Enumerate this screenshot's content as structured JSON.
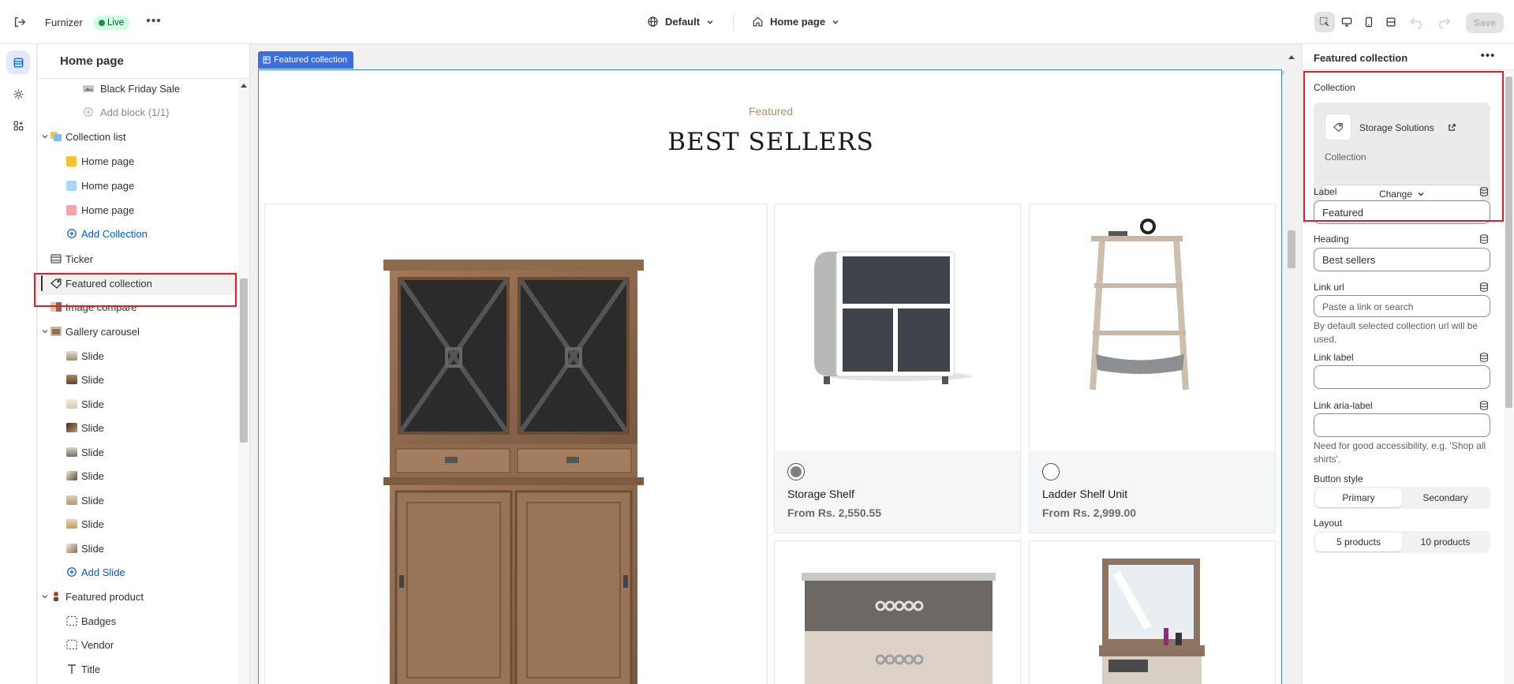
{
  "topbar": {
    "store_name": "Furnizer",
    "status": "Live",
    "theme": "Default",
    "page": "Home page",
    "save_label": "Save",
    "icons": [
      "exit-icon",
      "globe-icon",
      "home-icon",
      "inspector-icon",
      "desktop-icon",
      "mobile-icon",
      "fullwidth-icon",
      "undo-icon",
      "redo-icon"
    ]
  },
  "sidebar": {
    "title": "Home page",
    "items": [
      {
        "label": "Black Friday Sale"
      },
      {
        "label": "Add block (1/1)"
      },
      {
        "label": "Collection list"
      },
      {
        "label": "Home page"
      },
      {
        "label": "Home page"
      },
      {
        "label": "Home page"
      },
      {
        "label": "Add Collection"
      },
      {
        "label": "Ticker"
      },
      {
        "label": "Featured collection"
      },
      {
        "label": "Image compare"
      },
      {
        "label": "Gallery carousel"
      },
      {
        "label": "Slide"
      },
      {
        "label": "Slide"
      },
      {
        "label": "Slide"
      },
      {
        "label": "Slide"
      },
      {
        "label": "Slide"
      },
      {
        "label": "Slide"
      },
      {
        "label": "Slide"
      },
      {
        "label": "Slide"
      },
      {
        "label": "Slide"
      },
      {
        "label": "Add Slide"
      },
      {
        "label": "Featured product"
      },
      {
        "label": "Badges"
      },
      {
        "label": "Vendor"
      },
      {
        "label": "Title"
      }
    ]
  },
  "preview": {
    "section_tag": "Featured collection",
    "label": "Featured",
    "heading": "BEST SELLERS",
    "products": [
      {
        "name": "Storage Shelf",
        "price": "From Rs. 2,550.55"
      },
      {
        "name": "Ladder Shelf Unit",
        "price": "From Rs. 2,999.00"
      }
    ]
  },
  "settings": {
    "title": "Featured collection",
    "collection_label": "Collection",
    "collection_name": "Storage Solutions",
    "collection_type": "Collection",
    "change_label": "Change",
    "label_label": "Label",
    "label_value": "Featured",
    "heading_label": "Heading",
    "heading_value": "Best sellers",
    "link_url_label": "Link url",
    "link_url_placeholder": "Paste a link or search",
    "link_url_help": "By default selected collection url will be used.",
    "link_label_label": "Link label",
    "link_label_value": "",
    "link_aria_label": "Link aria-label",
    "link_aria_value": "",
    "link_aria_help": "Need for good accessibility, e.g. 'Shop all shirts'.",
    "button_style_label": "Button style",
    "button_style_options": [
      "Primary",
      "Secondary"
    ],
    "layout_label": "Layout",
    "layout_options": [
      "5 products",
      "10 products"
    ]
  },
  "colors": {
    "accent": "#005bd3",
    "highlight": "#e51c23",
    "live_bg": "#cdfee1",
    "section_tag": "#3b6fe0",
    "label_gold": "#b0906a"
  }
}
